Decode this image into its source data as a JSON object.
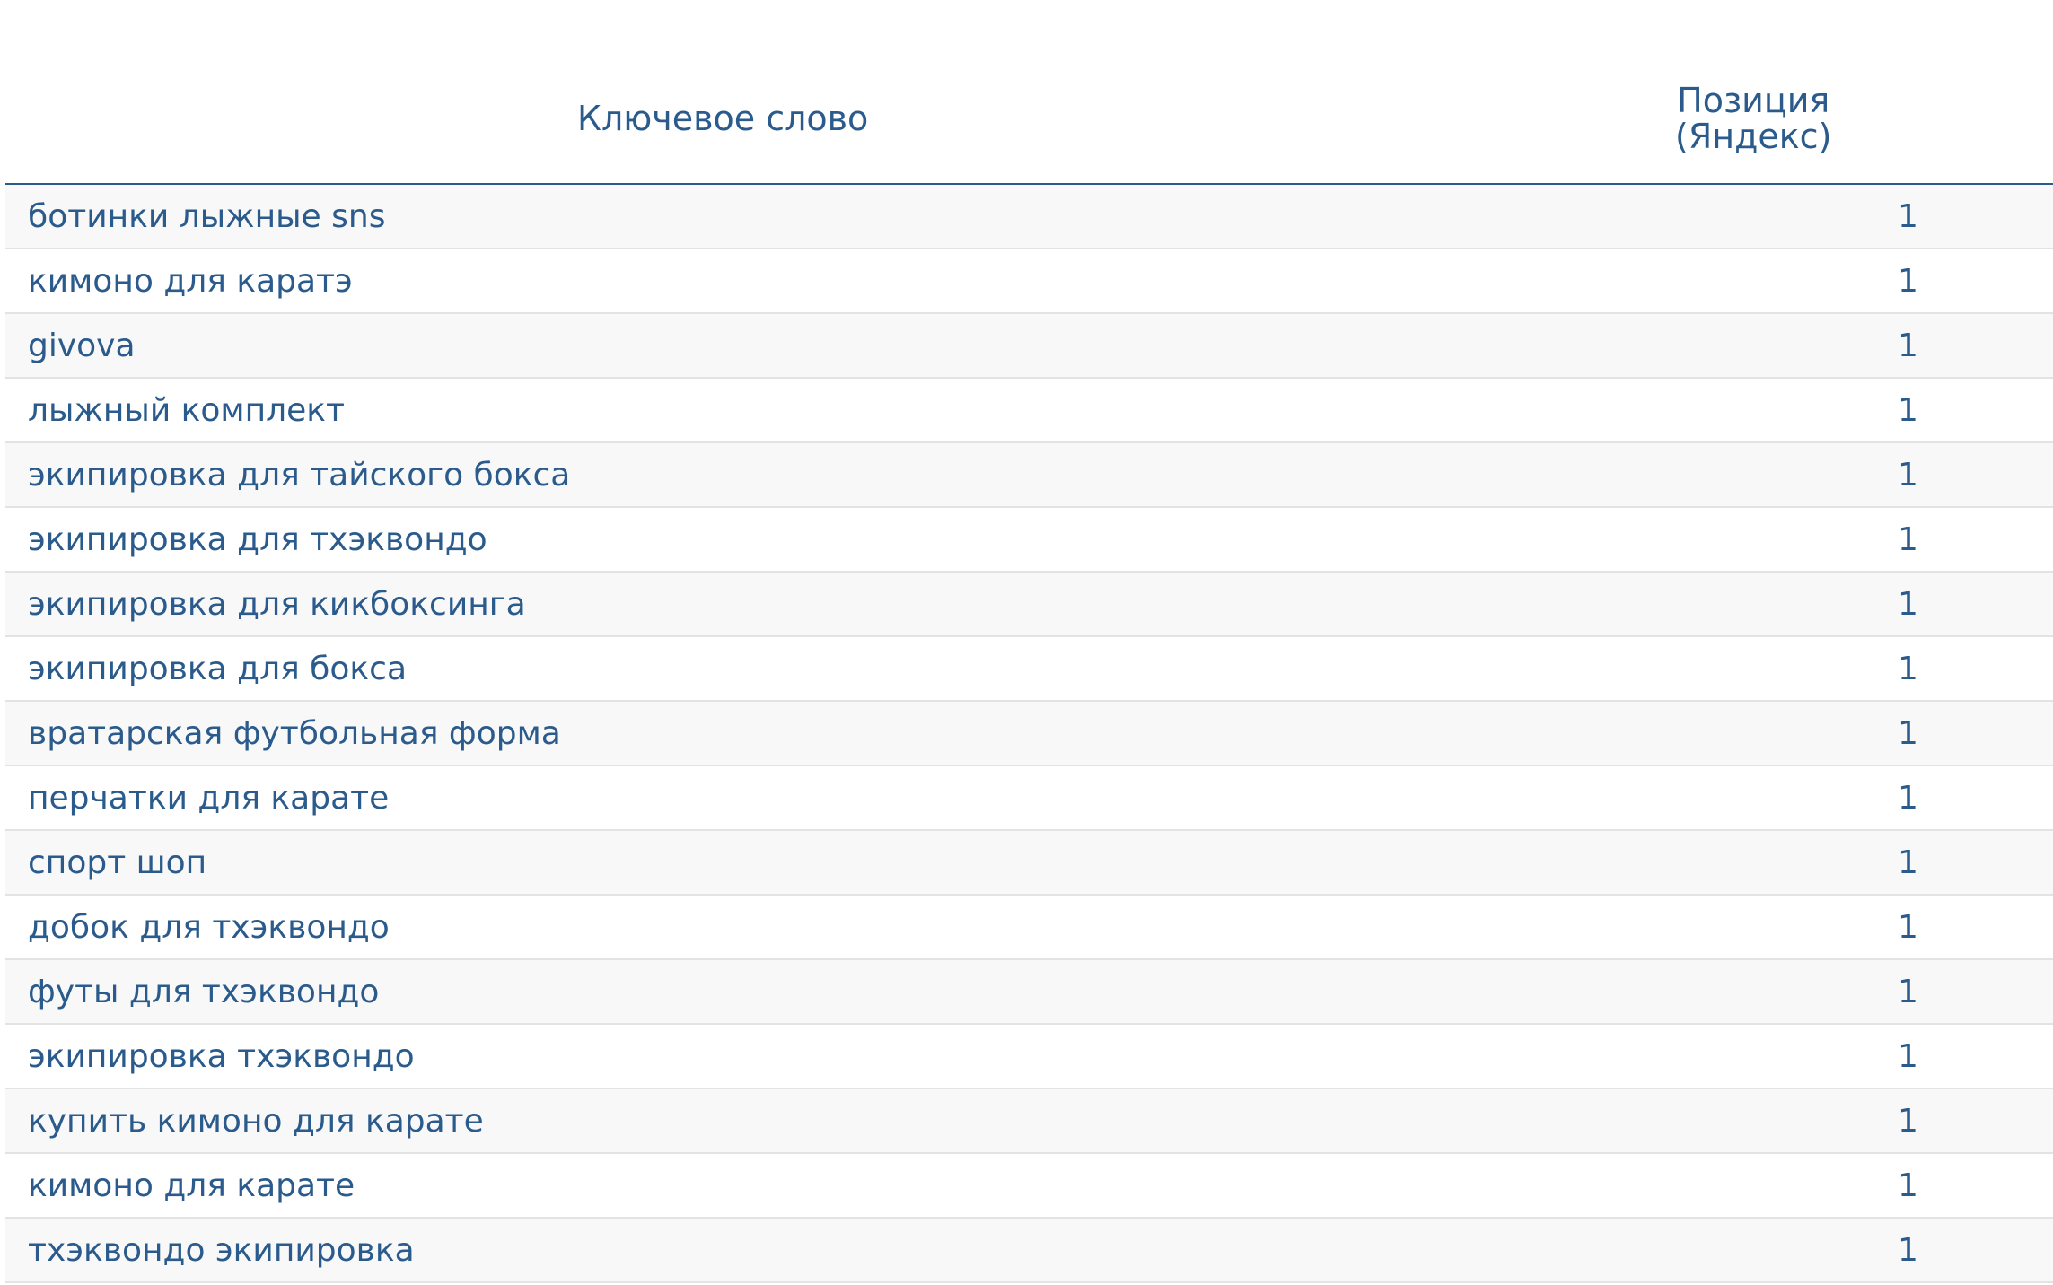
{
  "table": {
    "headers": {
      "keyword": "Ключевое слово",
      "position_line1": "Позиция",
      "position_line2": "(Яндекс)"
    },
    "rows": [
      {
        "keyword": "ботинки лыжные sns",
        "position": "1"
      },
      {
        "keyword": "кимоно для каратэ",
        "position": "1"
      },
      {
        "keyword": "givova",
        "position": "1"
      },
      {
        "keyword": "лыжный комплект",
        "position": "1"
      },
      {
        "keyword": "экипировка для тайского бокса",
        "position": "1"
      },
      {
        "keyword": "экипировка для тхэквондо",
        "position": "1"
      },
      {
        "keyword": "экипировка для кикбоксинга",
        "position": "1"
      },
      {
        "keyword": "экипировка для бокса",
        "position": "1"
      },
      {
        "keyword": "вратарская футбольная форма",
        "position": "1"
      },
      {
        "keyword": "перчатки для карате",
        "position": "1"
      },
      {
        "keyword": "спорт шоп",
        "position": "1"
      },
      {
        "keyword": "добок для тхэквондо",
        "position": "1"
      },
      {
        "keyword": "футы для тхэквондо",
        "position": "1"
      },
      {
        "keyword": "экипировка тхэквондо",
        "position": "1"
      },
      {
        "keyword": "купить кимоно для карате",
        "position": "1"
      },
      {
        "keyword": "кимоно для карате",
        "position": "1"
      },
      {
        "keyword": "тхэквондо экипировка",
        "position": "1"
      }
    ]
  },
  "colors": {
    "text": "#2a5b8c",
    "header_rule": "#2a5b8c",
    "row_alt": "#f8f8f8",
    "row_border": "#e3e3e3"
  }
}
